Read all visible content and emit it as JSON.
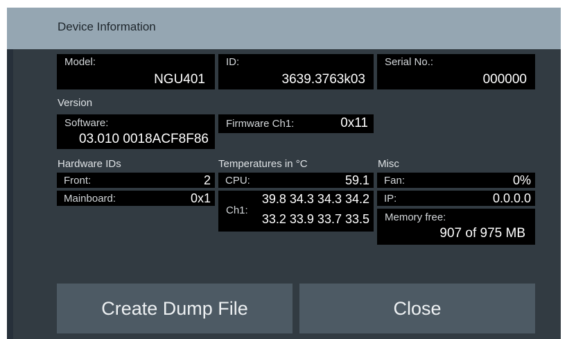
{
  "dialog": {
    "title": "Device Information"
  },
  "model": {
    "label": "Model:",
    "value": "NGU401"
  },
  "id": {
    "label": "ID:",
    "value": "3639.3763k03"
  },
  "serial": {
    "label": "Serial No.:",
    "value": "000000"
  },
  "version": {
    "heading": "Version",
    "software": {
      "label": "Software:",
      "value": "03.010 0018ACF8F86"
    },
    "firmware": {
      "label": "Firmware Ch1:",
      "value": "0x11"
    }
  },
  "hardware": {
    "heading": "Hardware IDs",
    "front": {
      "label": "Front:",
      "value": "2"
    },
    "mainboard": {
      "label": "Mainboard:",
      "value": "0x1"
    }
  },
  "temperatures": {
    "heading": "Temperatures in °C",
    "cpu": {
      "label": "CPU:",
      "value": "59.1"
    },
    "ch1": {
      "label": "Ch1:",
      "line1": "39.8 34.3 34.3 34.2",
      "line2": "33.2 33.9 33.7 33.5"
    }
  },
  "misc": {
    "heading": "Misc",
    "fan": {
      "label": "Fan:",
      "value": "0%"
    },
    "ip": {
      "label": "IP:",
      "value": "0.0.0.0"
    },
    "memory": {
      "label": "Memory free:",
      "value": "907 of 975 MB"
    }
  },
  "buttons": {
    "create_dump": "Create Dump File",
    "close": "Close"
  },
  "colors": {
    "titlebar": "#95a6b2",
    "background": "#323b42",
    "field": "#000000",
    "button": "#4d5a64"
  }
}
